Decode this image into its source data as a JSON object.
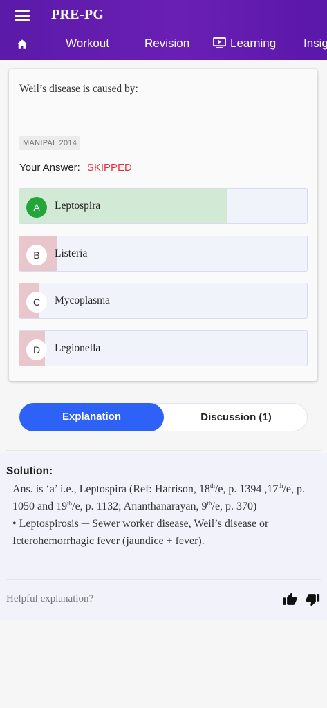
{
  "app": {
    "title": "PRE-PG"
  },
  "nav": {
    "items": [
      {
        "label": "Workout"
      },
      {
        "label": "Revision"
      },
      {
        "label": "Learning"
      },
      {
        "label": "Insig"
      }
    ]
  },
  "question": {
    "text": "Weil’s disease is caused by:",
    "tag": "MANIPAL 2014",
    "your_answer_label": "Your Answer:",
    "your_answer_value": "SKIPPED",
    "options": [
      {
        "letter": "A",
        "text": "Leptospira",
        "correct": true,
        "fill_fraction": 0.72
      },
      {
        "letter": "B",
        "text": "Listeria",
        "correct": false,
        "fill_fraction": 0.13
      },
      {
        "letter": "C",
        "text": "Mycoplasma",
        "correct": false,
        "fill_fraction": 0.07
      },
      {
        "letter": "D",
        "text": "Legionella",
        "correct": false,
        "fill_fraction": 0.09
      }
    ]
  },
  "tabs": {
    "explanation": "Explanation",
    "discussion": "Discussion (1)"
  },
  "solution": {
    "heading": "Solution:",
    "line1_a": "Ans. is ‘a’ i.e., Leptospira (Ref: Harrison, 18",
    "sup_th": "th",
    "line1_b": "/e, p. 1394 ,17",
    "line1_c": "/e, p. 1050 and 19",
    "line1_d": "/e, p. 1132; Ananthanarayan, 9",
    "line1_e": "/e, p. 370)",
    "bullet": "• Leptospirosis ─ Sewer worker disease, Weil’s disease or Icterohemorrhagic fever (jaundice + fever).",
    "helpful": "Helpful explanation?"
  },
  "colors": {
    "header": "#5b1aa8",
    "correct_fill": "#d2e9d6",
    "wrong_fill": "#e8c6cc",
    "correct_badge": "#24a53a",
    "skipped": "#e0333f",
    "tab_active": "#2e62f6"
  },
  "icons": [
    "menu-icon",
    "home-icon",
    "learning-icon",
    "thumbs-up-icon",
    "thumbs-down-icon"
  ]
}
